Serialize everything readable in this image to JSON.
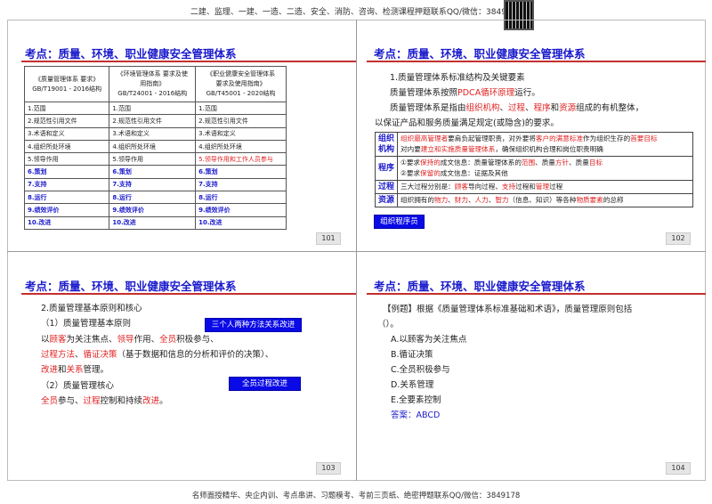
{
  "header": {
    "text": "二建、监理、一建、一造、二造、安全、消防、咨询、检测课程押题联系QQ/微信：3849178"
  },
  "footer": {
    "text": "名师面授精华、央企内训、考点串讲、习题模考、考前三页纸、绝密押题联系QQ/微信：3849178"
  },
  "slides": [
    {
      "title": "考点：质量、环境、职业健康安全管理体系",
      "page": "101",
      "table": {
        "headers": [
          "《质量管理体系 要求》\nGB/T19001 - 2016结构",
          "《环境管理体系 要求及使\n用指南》\nGB/T24001 - 2016结构",
          "《职业健康安全管理体系\n要求及使用指南》\nGB/T45001 - 2020结构"
        ],
        "rows": [
          [
            "1.范围",
            "1.范围",
            "1.范围"
          ],
          [
            "2.规范性引用文件",
            "2.规范性引用文件",
            "2.规范性引用文件"
          ],
          [
            "3.术语和定义",
            "3.术语和定义",
            "3.术语和定义"
          ],
          [
            "4.组织所处环境",
            "4.组织所处环境",
            "4.组织所处环境"
          ],
          [
            "5.领导作用",
            "5.领导作用",
            "5.领导作用和工作人员参与"
          ],
          [
            "6.策划",
            "6.策划",
            "6.策划"
          ],
          [
            "7.支持",
            "7.支持",
            "7.支持"
          ],
          [
            "8.运行",
            "8.运行",
            "8.运行"
          ],
          [
            "9.绩效评价",
            "9.绩效评价",
            "9.绩效评价"
          ],
          [
            "10.改进",
            "10.改进",
            "10.改进"
          ]
        ]
      }
    },
    {
      "title": "考点：质量、环境、职业健康安全管理体系",
      "page": "102",
      "lines": [
        [
          {
            "t": "1.质量管理体系标准结构及关键要素"
          }
        ],
        [
          {
            "t": "质量管理体系按照"
          },
          {
            "t": "PDCA循环原理",
            "r": 1
          },
          {
            "t": "运行。"
          }
        ],
        [
          {
            "t": "质量管理体系是指由"
          },
          {
            "t": "组织机构",
            "r": 1
          },
          {
            "t": "、"
          },
          {
            "t": "过程",
            "r": 1
          },
          {
            "t": "、"
          },
          {
            "t": "程序",
            "r": 1
          },
          {
            "t": "和"
          },
          {
            "t": "资源",
            "r": 1
          },
          {
            "t": "组成的有机整体，"
          }
        ],
        [
          {
            "t": "以保证产品和服务质量满足规定(或隐含)的要求。"
          }
        ]
      ],
      "table": [
        {
          "key": "组织机构",
          "lines": [
            [
              {
                "t": "组织最高管理者",
                "r": 1
              },
              {
                "t": "要肩负起管理职责，对外要将"
              },
              {
                "t": "客户的满意标准",
                "r": 1
              },
              {
                "t": "作为组织生存的"
              },
              {
                "t": "首要目标",
                "r": 1
              }
            ],
            [
              {
                "t": "对内要"
              },
              {
                "t": "建立和实施质量管理体系",
                "r": 1
              },
              {
                "t": "，确保组织机构合理和岗位职责明确"
              }
            ]
          ]
        },
        {
          "key": "程序",
          "lines": [
            [
              {
                "t": "①要求"
              },
              {
                "t": "保持的",
                "r": 1
              },
              {
                "t": "成文信息：质量管理体系的"
              },
              {
                "t": "范围",
                "r": 1
              },
              {
                "t": "、质量"
              },
              {
                "t": "方针",
                "r": 1
              },
              {
                "t": "、质量"
              },
              {
                "t": "目标",
                "r": 1
              }
            ],
            [
              {
                "t": "②要求"
              },
              {
                "t": "保留的",
                "r": 1
              },
              {
                "t": "成文信息：证据及其他"
              }
            ]
          ]
        },
        {
          "key": "过程",
          "lines": [
            [
              {
                "t": "三大过程分别是："
              },
              {
                "t": "顾客",
                "r": 1
              },
              {
                "t": "导向过程、"
              },
              {
                "t": "支持",
                "r": 1
              },
              {
                "t": "过程和"
              },
              {
                "t": "管理",
                "r": 1
              },
              {
                "t": "过程"
              }
            ]
          ]
        },
        {
          "key": "资源",
          "lines": [
            [
              {
                "t": "组织拥有的"
              },
              {
                "t": "物力",
                "r": 1
              },
              {
                "t": "、"
              },
              {
                "t": "财力",
                "r": 1
              },
              {
                "t": "、"
              },
              {
                "t": "人力",
                "r": 1
              },
              {
                "t": "、"
              },
              {
                "t": "智力",
                "r": 1
              },
              {
                "t": "（信息、知识）等各种"
              },
              {
                "t": "物质要素",
                "r": 1
              },
              {
                "t": "的总称"
              }
            ]
          ]
        }
      ],
      "button": "组织程序员"
    },
    {
      "title": "考点：质量、环境、职业健康安全管理体系",
      "page": "103",
      "lines": [
        [
          {
            "t": "2.质量管理基本原则和核心"
          }
        ],
        [
          {
            "t": "（1）质量管理基本原则"
          }
        ],
        [
          {
            "t": "以"
          },
          {
            "t": "顾客",
            "r": 1
          },
          {
            "t": "为关注焦点、"
          },
          {
            "t": "领导",
            "r": 1
          },
          {
            "t": "作用、"
          },
          {
            "t": "全员",
            "r": 1
          },
          {
            "t": "积极参与、"
          }
        ],
        [
          {
            "t": "过程方法",
            "r": 1
          },
          {
            "t": "、"
          },
          {
            "t": "循证决策",
            "r": 1
          },
          {
            "t": "（基于数据和信息的分析和评价的决策）、"
          }
        ],
        [
          {
            "t": "改进",
            "r": 1
          },
          {
            "t": "和"
          },
          {
            "t": "关系",
            "r": 1
          },
          {
            "t": "管理。"
          }
        ],
        [
          {
            "t": "（2）质量管理核心"
          }
        ],
        [
          {
            "t": "全员",
            "r": 1
          },
          {
            "t": "参与、"
          },
          {
            "t": "过程",
            "r": 1
          },
          {
            "t": "控制和持续"
          },
          {
            "t": "改进",
            "r": 1
          },
          {
            "t": "。"
          }
        ]
      ],
      "buttons": [
        "三个人两种方法关系改进",
        "全员过程改进"
      ]
    },
    {
      "title": "考点：质量、环境、职业健康安全管理体系",
      "page": "104",
      "question": "【例题】根据《质量管理体系标准基础和术语》，质量管理原则包括",
      "blank": "（）。",
      "options": [
        "A.以顾客为关注焦点",
        "B.循证决策",
        "C.全员积极参与",
        "D.关系管理",
        "E.全要素控制"
      ],
      "answer": "答案：ABCD"
    }
  ],
  "colors": {
    "title": "#1a1acc",
    "highlight": "#e02020",
    "rule": "#c43030",
    "button": "#0a0ae6"
  }
}
